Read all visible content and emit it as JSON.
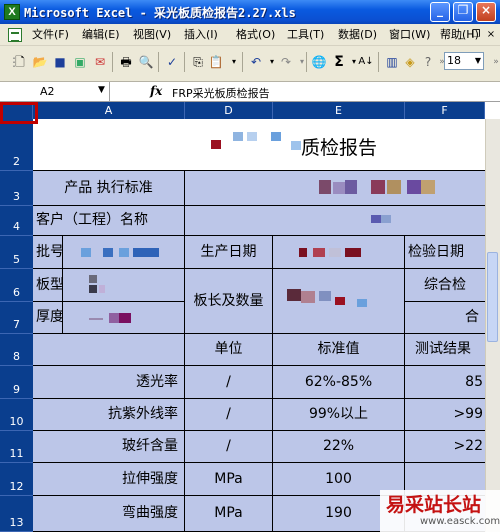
{
  "window": {
    "title": "Microsoft Excel - 采光板质检报告2.27.xls",
    "app_icon": "X"
  },
  "menubar": {
    "items": [
      "文件(F)",
      "编辑(E)",
      "视图(V)",
      "插入(I)",
      "格式(O)",
      "工具(T)",
      "数据(D)",
      "窗口(W)",
      "帮助(H)"
    ],
    "mdi_min": "_",
    "mdi_restore": "❐",
    "mdi_close": "×"
  },
  "toolbar": {
    "zoom": "18",
    "sum_icon": "Σ"
  },
  "formula_bar": {
    "cell_ref": "A2",
    "fx": "fx",
    "formula": "FRP采光板质检报告"
  },
  "grid": {
    "columns": [
      "A",
      "D",
      "E",
      "F"
    ],
    "rows": [
      "2",
      "3",
      "4",
      "5",
      "6",
      "7",
      "8",
      "9",
      "10",
      "11",
      "12",
      "13"
    ],
    "title": "质检报告",
    "r3": {
      "label": "产品 执行标准"
    },
    "r4": {
      "label": "客户（工程）名称"
    },
    "r5": {
      "batch": "批号",
      "prod_date": "生产日期",
      "test_date": "检验日期"
    },
    "r6": {
      "board_type": "板型",
      "length_qty": "板长及数量",
      "overall": "综合检"
    },
    "r7": {
      "thickness": "厚度",
      "partial": "合"
    },
    "r8": {
      "unit": "单位",
      "standard": "标准值",
      "result": "测试结果"
    },
    "items": [
      {
        "name": "透光率",
        "unit": "/",
        "std": "62%-85%",
        "result": "85"
      },
      {
        "name": "抗紫外线率",
        "unit": "/",
        "std": "99%以上",
        "result": ">99"
      },
      {
        "name": "玻纤含量",
        "unit": "/",
        "std": "22%",
        "result": ">22"
      },
      {
        "name": "拉伸强度",
        "unit": "MPa",
        "std": "100",
        "result": ""
      },
      {
        "name": "弯曲强度",
        "unit": "MPa",
        "std": "190",
        "result": ""
      }
    ]
  },
  "watermark": {
    "text": "易采站长站",
    "url": "www.easck.com"
  }
}
